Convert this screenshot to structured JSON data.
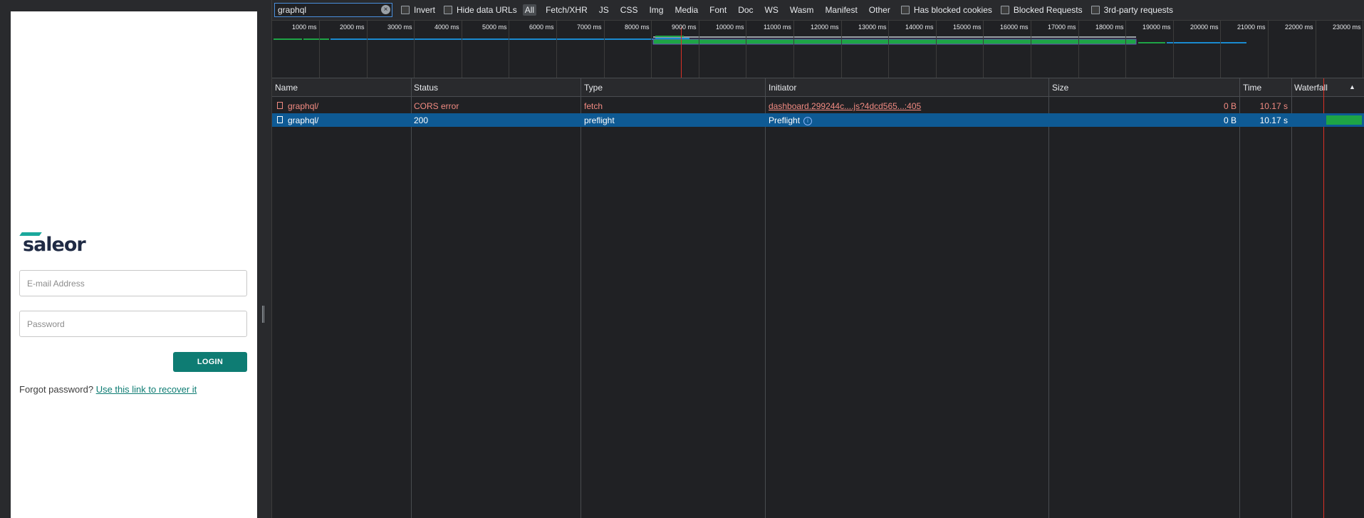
{
  "app": {
    "logo_text": "saleor",
    "email_placeholder": "E-mail Address",
    "password_placeholder": "Password",
    "login_label": "LOGIN",
    "forgot_text": "Forgot password?",
    "recover_link": "Use this link to recover it",
    "accent_color": "#0e7c73"
  },
  "filter_bar": {
    "filter_value": "graphql",
    "invert_label": "Invert",
    "hide_data_urls_label": "Hide data URLs",
    "type_filters": [
      "All",
      "Fetch/XHR",
      "JS",
      "CSS",
      "Img",
      "Media",
      "Font",
      "Doc",
      "WS",
      "Wasm",
      "Manifest",
      "Other"
    ],
    "active_type": "All",
    "has_blocked_cookies_label": "Has blocked cookies",
    "blocked_requests_label": "Blocked Requests",
    "third_party_label": "3rd-party requests"
  },
  "overview": {
    "ticks": [
      "1000 ms",
      "2000 ms",
      "3000 ms",
      "4000 ms",
      "5000 ms",
      "6000 ms",
      "7000 ms",
      "8000 ms",
      "9000 ms",
      "10000 ms",
      "11000 ms",
      "12000 ms",
      "13000 ms",
      "14000 ms",
      "15000 ms",
      "16000 ms",
      "17000 ms",
      "18000 ms",
      "19000 ms",
      "20000 ms",
      "21000 ms",
      "22000 ms",
      "23000 ms"
    ]
  },
  "table": {
    "columns": [
      "Name",
      "Status",
      "Type",
      "Initiator",
      "Size",
      "Time",
      "Waterfall"
    ],
    "rows": [
      {
        "name": "graphql/",
        "status": "CORS error",
        "type": "fetch",
        "initiator": "dashboard.299244c....js?4dcd565...:405",
        "size": "0 B",
        "time": "10.17 s"
      },
      {
        "name": "graphql/",
        "status": "200",
        "type": "preflight",
        "initiator": "Preflight",
        "size": "0 B",
        "time": "10.17 s"
      }
    ]
  },
  "colors": {
    "error_text": "#f28b82",
    "selected_row": "#0e5a94",
    "waterfall_bar": "#1ea446",
    "blue_bar": "#1a8ad0",
    "red_marker": "#d93025"
  }
}
